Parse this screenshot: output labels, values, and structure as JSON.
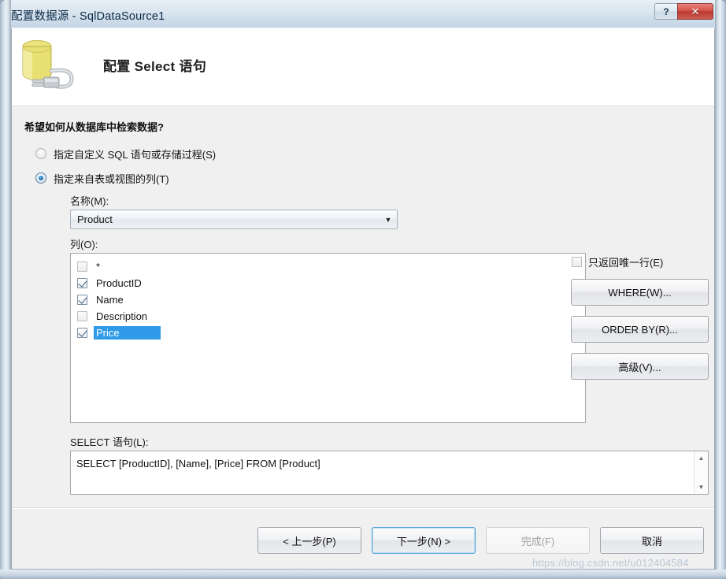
{
  "window": {
    "title": "配置数据源 - SqlDataSource1",
    "help_button": "?",
    "close_button": "✕"
  },
  "header": {
    "title": "配置 Select 语句",
    "icon": "database-plug-icon"
  },
  "body": {
    "question_label": "希望如何从数据库中检索数据?",
    "radios": [
      {
        "label": "指定自定义 SQL 语句或存储过程(S)",
        "accel": "S",
        "checked": false
      },
      {
        "label": "指定来自表或视图的列(T)",
        "accel": "T",
        "checked": true
      }
    ],
    "name": {
      "label": "名称(M):",
      "value": "Product",
      "arrow": "▼"
    },
    "columns": {
      "label": "列(O):",
      "items": [
        {
          "label": "*",
          "checked": false,
          "selected": false
        },
        {
          "label": "ProductID",
          "checked": true,
          "selected": false
        },
        {
          "label": "Name",
          "checked": true,
          "selected": false
        },
        {
          "label": "Description",
          "checked": false,
          "selected": false
        },
        {
          "label": "Price",
          "checked": true,
          "selected": true
        }
      ]
    },
    "unique_checkbox": {
      "label": "只返回唯一行(E)",
      "checked": false
    },
    "side_buttons": [
      {
        "label": "WHERE(W)..."
      },
      {
        "label": "ORDER BY(R)..."
      },
      {
        "label": "高级(V)..."
      }
    ],
    "select_statement": {
      "label": "SELECT 语句(L):",
      "value": "SELECT [ProductID], [Name], [Price] FROM [Product]",
      "scroll_up": "▲",
      "scroll_down": "▼"
    }
  },
  "footer": {
    "buttons": [
      {
        "label": "< 上一步(P)",
        "state": "normal"
      },
      {
        "label": "下一步(N) >",
        "state": "focused"
      },
      {
        "label": "完成(F)",
        "state": "disabled"
      },
      {
        "label": "取消",
        "state": "normal"
      }
    ]
  },
  "watermark": "https://blog.csdn.net/u012404584",
  "colors": {
    "selection_blue": "#2f9ae8",
    "close_red": "#bb3a31",
    "focus_blue": "#4fa2d8",
    "body_gray": "#f0f0f0"
  }
}
